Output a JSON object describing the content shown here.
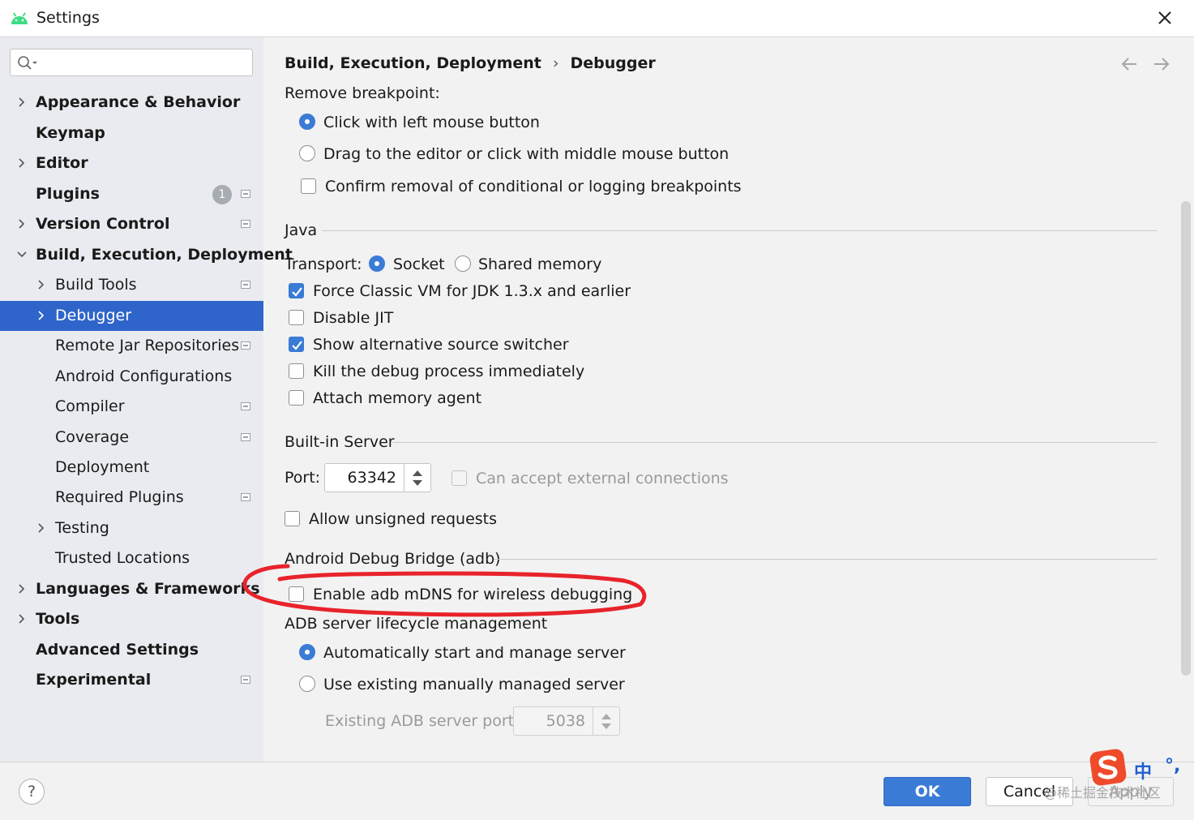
{
  "window": {
    "title": "Settings"
  },
  "search": {
    "placeholder": ""
  },
  "sidebar": {
    "items": [
      {
        "label": "Appearance & Behavior"
      },
      {
        "label": "Keymap"
      },
      {
        "label": "Editor"
      },
      {
        "label": "Plugins",
        "badge": "1"
      },
      {
        "label": "Version Control"
      },
      {
        "label": "Build, Execution, Deployment"
      },
      {
        "label": "Build Tools"
      },
      {
        "label": "Debugger"
      },
      {
        "label": "Remote Jar Repositories"
      },
      {
        "label": "Android Configurations"
      },
      {
        "label": "Compiler"
      },
      {
        "label": "Coverage"
      },
      {
        "label": "Deployment"
      },
      {
        "label": "Required Plugins"
      },
      {
        "label": "Testing"
      },
      {
        "label": "Trusted Locations"
      },
      {
        "label": "Languages & Frameworks"
      },
      {
        "label": "Tools"
      },
      {
        "label": "Advanced Settings"
      },
      {
        "label": "Experimental"
      }
    ]
  },
  "breadcrumb": {
    "parent": "Build, Execution, Deployment",
    "separator": "›",
    "current": "Debugger"
  },
  "remove_breakpoint": {
    "label": "Remove breakpoint:",
    "options": [
      {
        "label": "Click with left mouse button",
        "selected": true
      },
      {
        "label": "Drag to the editor or click with middle mouse button",
        "selected": false
      }
    ],
    "confirm_label": "Confirm removal of conditional or logging breakpoints",
    "confirm_checked": false
  },
  "java": {
    "section_title": "Java",
    "transport_label": "Transport:",
    "transport_options": [
      {
        "label": "Socket",
        "selected": true
      },
      {
        "label": "Shared memory",
        "selected": false
      }
    ],
    "checks": [
      {
        "label": "Force Classic VM for JDK 1.3.x and earlier",
        "checked": true
      },
      {
        "label": "Disable JIT",
        "checked": false
      },
      {
        "label": "Show alternative source switcher",
        "checked": true
      },
      {
        "label": "Kill the debug process immediately",
        "checked": false
      },
      {
        "label": "Attach memory agent",
        "checked": false
      }
    ]
  },
  "builtin_server": {
    "section_title": "Built-in Server",
    "port_label": "Port:",
    "port_value": "63342",
    "external_label": "Can accept external connections",
    "external_checked": false,
    "unsigned_label": "Allow unsigned requests",
    "unsigned_checked": false
  },
  "adb": {
    "section_title": "Android Debug Bridge (adb)",
    "mdns_label": "Enable adb mDNS for wireless debugging",
    "mdns_checked": false,
    "lifecycle_label": "ADB server lifecycle management",
    "lifecycle_options": [
      {
        "label": "Automatically start and manage server",
        "selected": true
      },
      {
        "label": "Use existing manually managed server",
        "selected": false
      }
    ],
    "existing_port_label": "Existing ADB server port:",
    "existing_port_value": "5038"
  },
  "buttons": {
    "help": "?",
    "ok": "OK",
    "cancel": "Cancel",
    "apply": "Apply"
  },
  "watermark": "@稀土掘金技术社区",
  "ime": {
    "chinese": "中",
    "punct": "°,"
  },
  "colors": {
    "accent": "#3a7bd5",
    "selection": "#2f65ca",
    "annotation": "#e8232b"
  }
}
